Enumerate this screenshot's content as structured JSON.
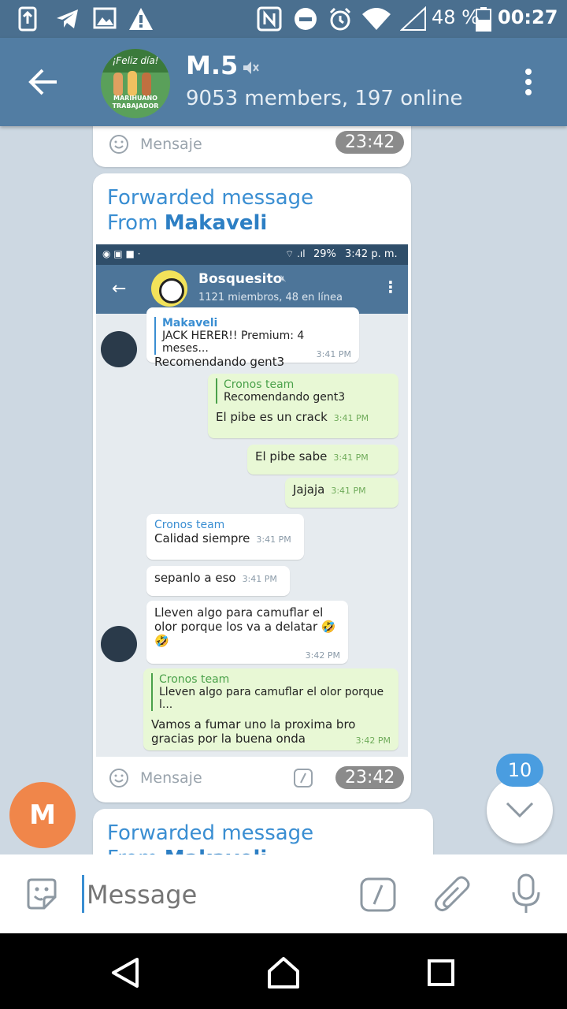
{
  "status_bar": {
    "battery": "48 %",
    "time": "00:27"
  },
  "header": {
    "title": "M.5",
    "subtitle": "9053 members, 197 online",
    "avatar_text_top": "¡Feliz día!",
    "avatar_text_bottom": "MARIHUANO TRABAJADOR"
  },
  "top_bubble": {
    "placeholder": "Mensaje",
    "time": "23:42"
  },
  "forwarded": {
    "label": "Forwarded message",
    "from_prefix": "From",
    "from_name": "Makaveli",
    "time": "23:42",
    "input_placeholder": "Mensaje"
  },
  "embedded": {
    "status_battery": "29%",
    "status_time": "3:42 p. m.",
    "chat_title": "Bosquesito",
    "chat_subtitle": "1121 miembros, 48 en línea",
    "messages": [
      {
        "name": "Makaveli",
        "quote": "JACK HERER!! Premium: 4 meses...",
        "text": "Recomendando gent3",
        "time": "3:41 PM"
      },
      {
        "name": "Cronos team",
        "quote": "Recomendando gent3",
        "text": "El pibe es un crack",
        "time": "3:41 PM"
      },
      {
        "text": "El pibe sabe",
        "time": "3:41 PM"
      },
      {
        "text": "Jajaja",
        "time": "3:41 PM"
      },
      {
        "name": "Cronos team",
        "text": "Calidad siempre",
        "time": "3:41 PM"
      },
      {
        "text": "sepanlo a eso",
        "time": "3:41 PM"
      },
      {
        "text_line1": "Lleven algo para camuflar el",
        "text_line2": "olor porque los va a delatar 🤣",
        "text_line3": "🤣",
        "time": "3:42 PM"
      },
      {
        "name": "Cronos team",
        "quote": "Lleven algo para camuflar el olor porque l...",
        "text_line1": "Vamos a fumar uno la proxima bro",
        "text_line2": "gracias por la buena onda",
        "time": "3:42 PM"
      }
    ]
  },
  "second_forward": {
    "label": "Forwarded message",
    "from_prefix": "From",
    "from_name": "Makaveli"
  },
  "unread_badge": "10",
  "user_avatar_letter": "M",
  "input": {
    "placeholder": "Message"
  },
  "colors": {
    "header": "#527da3",
    "status_bar": "#4a6f8f",
    "link": "#3a8ed2",
    "avatar_orange": "#f0864a",
    "badge_blue": "#4a9de0"
  }
}
